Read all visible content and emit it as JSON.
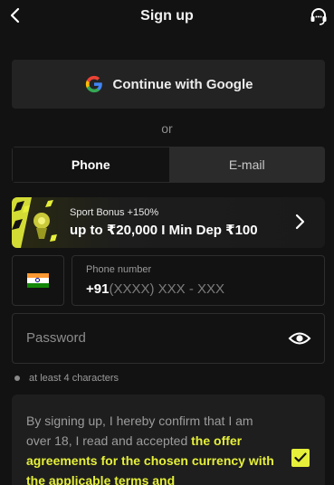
{
  "header": {
    "title": "Sign up",
    "back_icon": "chevron-left-icon",
    "support_icon": "headset-icon"
  },
  "google": {
    "label": "Continue with Google",
    "icon": "google-icon"
  },
  "divider": {
    "text": "or"
  },
  "tabs": [
    {
      "label": "Phone",
      "active": true
    },
    {
      "label": "E-mail",
      "active": false
    }
  ],
  "bonus": {
    "line1": "Sport Bonus +150%",
    "line2": "up to ₹20,000 I Min Dep ₹100",
    "icon": "chevron-right-icon"
  },
  "phone": {
    "country_flag": "india-flag-icon",
    "label": "Phone number",
    "code": "+91",
    "placeholder": "(XXXX) XXX - XXX"
  },
  "password": {
    "placeholder": "Password",
    "icon": "eye-icon",
    "hint": "at least 4 characters"
  },
  "agreement": {
    "text_before": "By signing up, I hereby confirm that I am over 18, I read and accepted ",
    "highlight": "the offer agreements for the chosen currency with the applicable terms and",
    "checked": true
  },
  "colors": {
    "background": "#121212",
    "accent": "#e6f03a",
    "surface": "#232323"
  }
}
